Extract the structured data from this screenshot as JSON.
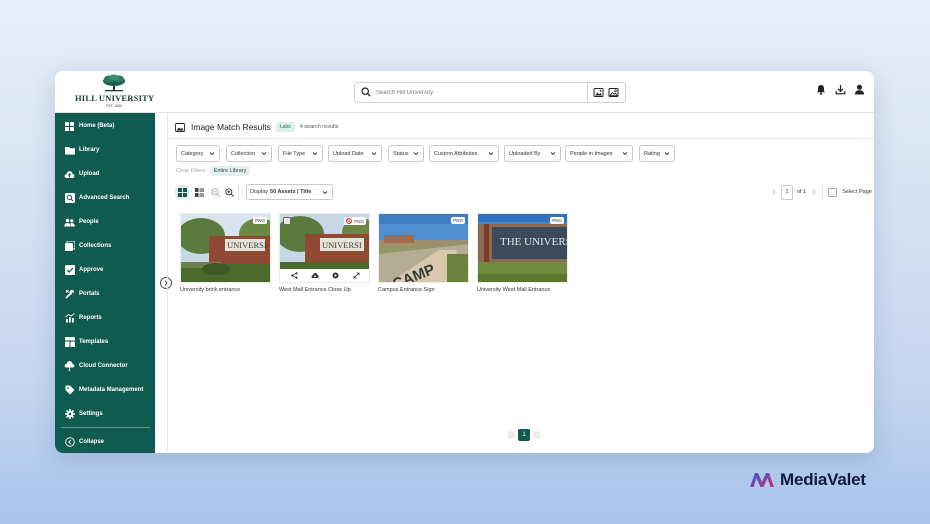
{
  "header": {
    "logo_name": "HILL UNIVERSITY",
    "logo_est": "EST. 1886",
    "search_placeholder": "Search Hill University"
  },
  "sidebar": {
    "items": [
      {
        "label": "Home (Beta)",
        "icon": "dashboard-icon"
      },
      {
        "label": "Library",
        "icon": "folder-icon"
      },
      {
        "label": "Upload",
        "icon": "cloud-upload-icon"
      },
      {
        "label": "Advanced Search",
        "icon": "advanced-search-icon"
      },
      {
        "label": "People",
        "icon": "people-icon"
      },
      {
        "label": "Collections",
        "icon": "collections-icon"
      },
      {
        "label": "Approve",
        "icon": "approve-check-icon"
      },
      {
        "label": "Portals",
        "icon": "portals-tools-icon"
      },
      {
        "label": "Reports",
        "icon": "reports-chart-icon"
      },
      {
        "label": "Templates",
        "icon": "templates-icon"
      },
      {
        "label": "Cloud Connector",
        "icon": "cloud-connector-icon"
      },
      {
        "label": "Metadata Management",
        "icon": "metadata-tag-icon"
      },
      {
        "label": "Settings",
        "icon": "gear-icon"
      }
    ],
    "collapse_label": "Collapse"
  },
  "results": {
    "title": "Image Match Results",
    "badge": "Labs",
    "count": "4 search results"
  },
  "filters": [
    "Category",
    "Collection",
    "File Type",
    "Upload Date",
    "Status",
    "Custom Attributes",
    "Uploaded By",
    "People in Images",
    "Rating"
  ],
  "clear_filters": "Clear Filters",
  "active_chip": "Entire Library",
  "toolbar": {
    "display_prefix": "Display",
    "display_value": "50 Assets | Title",
    "page_current": "1",
    "page_total": "of 1",
    "select_page": "Select Page"
  },
  "assets": [
    {
      "title": "University brick entrance",
      "type": "PNG"
    },
    {
      "title": "West Mall Entrance Close Up",
      "type": "PNG"
    },
    {
      "title": "Campus Entrance Sign",
      "type": "PNG"
    },
    {
      "title": "University West Mall Entrance",
      "type": "PNG"
    }
  ],
  "pagination": {
    "current": "1"
  },
  "brand": {
    "name": "MediaValet",
    "color": "#101b3d"
  },
  "colors": {
    "sidebar": "#105b4f",
    "accent": "#105b4f"
  }
}
